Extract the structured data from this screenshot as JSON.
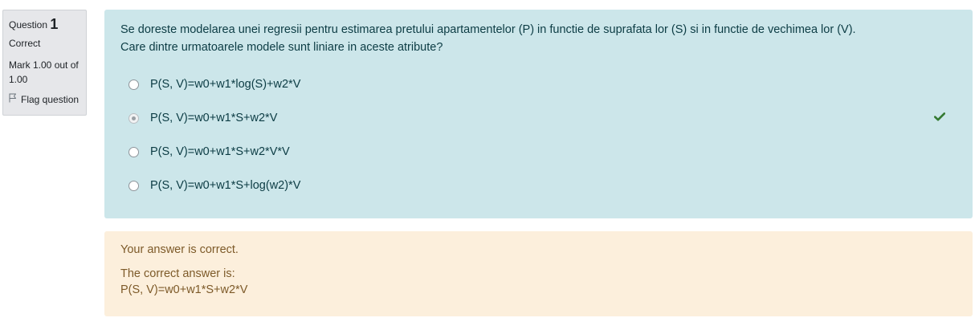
{
  "info": {
    "question_word": "Question",
    "question_number": "1",
    "state": "Correct",
    "grade": "Mark 1.00 out of 1.00",
    "flag_label": "Flag question"
  },
  "question": {
    "text_line1": "Se doreste modelarea unei regresii pentru estimarea pretului apartamentelor (P) in functie de suprafata lor (S) si in functie de vechimea lor (V).",
    "text_line2": "Care dintre urmatoarele modele sunt liniare in aceste atribute?",
    "answers": [
      {
        "label": "P(S, V)=w0+w1*log(S)+w2*V",
        "selected": false
      },
      {
        "label": "P(S, V)=w0+w1*S+w2*V",
        "selected": true,
        "mark": "correct"
      },
      {
        "label": "P(S, V)=w0+w1*S+w2*V*V",
        "selected": false
      },
      {
        "label": "P(S, V)=w0+w1*S+log(w2)*V",
        "selected": false
      }
    ]
  },
  "outcome": {
    "feedback": "Your answer is correct.",
    "right_answer_intro": "The correct answer is:",
    "right_answer": "P(S, V)=w0+w1*S+w2*V"
  },
  "colors": {
    "formulation_bg": "#cce6ea",
    "outcome_bg": "#fcefdc",
    "info_bg": "#e6e7ea",
    "correct_check": "#357a32"
  }
}
